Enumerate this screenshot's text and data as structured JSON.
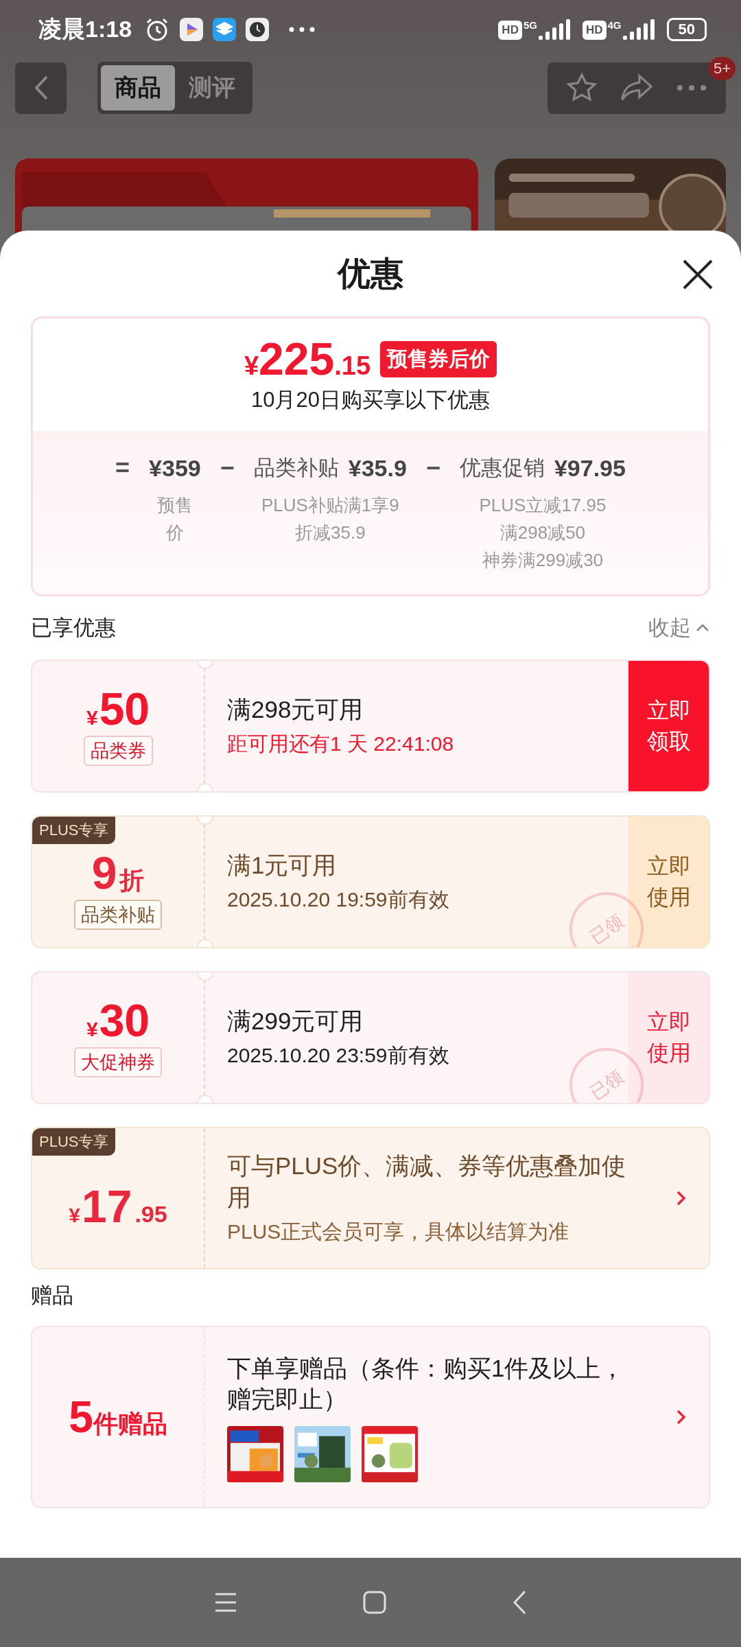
{
  "status_bar": {
    "time": "凌晨1:18",
    "signals": [
      {
        "hd": "HD",
        "network": "5G"
      },
      {
        "hd": "HD",
        "network": "4G"
      }
    ],
    "battery": "50"
  },
  "nav": {
    "tabs": [
      {
        "label": "商品",
        "selected": true
      },
      {
        "label": "测评",
        "selected": false
      }
    ],
    "badge": "5+"
  },
  "sheet": {
    "title": "优惠",
    "summary": {
      "currency": "¥",
      "price": "225",
      "decimals": ".15",
      "tag": "预售券后价",
      "subtitle": "10月20日购买享以下优惠",
      "terms": [
        {
          "operator": "=",
          "amount": "¥359",
          "notes": [
            "预售价"
          ]
        },
        {
          "operator": "−",
          "name": "品类补贴",
          "amount": "¥35.9",
          "notes": [
            "PLUS补贴满1享9折减35.9"
          ]
        },
        {
          "operator": "−",
          "name": "优惠促销",
          "amount": "¥97.95",
          "notes": [
            "PLUS立减17.95",
            "满298减50",
            "神券满299减30"
          ]
        }
      ]
    },
    "applied": {
      "heading": "已享优惠",
      "toggle": "收起",
      "expanded": true
    },
    "offers": [
      {
        "kind": "coupon",
        "currency": "¥",
        "amount": "50",
        "tag": "品类券",
        "title": "满298元可用",
        "note": "距可用还有1 天 22:41:08",
        "highlighted": true,
        "action": {
          "label": "立即领取",
          "primary": true
        }
      },
      {
        "kind": "coupon",
        "badge": "PLUS专享",
        "amount": "9",
        "unit": "折",
        "tag": "品类补贴",
        "title": "满1元可用",
        "note": "2025.10.20 19:59前有效",
        "highlighted": false,
        "action": {
          "label": "立即使用",
          "primary": false
        },
        "stamp": "已领"
      },
      {
        "kind": "coupon",
        "currency": "¥",
        "amount": "30",
        "tag": "大促神券",
        "title": "满299元可用",
        "note": "2025.10.20 23:59前有效",
        "highlighted": false,
        "action": {
          "label": "立即使用",
          "primary": false
        },
        "stamp": "已领"
      },
      {
        "kind": "link",
        "badge": "PLUS专享",
        "currency": "¥",
        "amount": "17",
        "unit": ".95",
        "title": "可与PLUS价、满减、券等优惠叠加使用",
        "note": "PLUS正式会员可享，具体以结算为准",
        "highlighted": false
      }
    ],
    "gifts": {
      "heading": "赠品",
      "count": "5",
      "unit": "件赠品",
      "title": "下单享赠品（条件：购买1件及以上，赠完即止）"
    }
  }
}
